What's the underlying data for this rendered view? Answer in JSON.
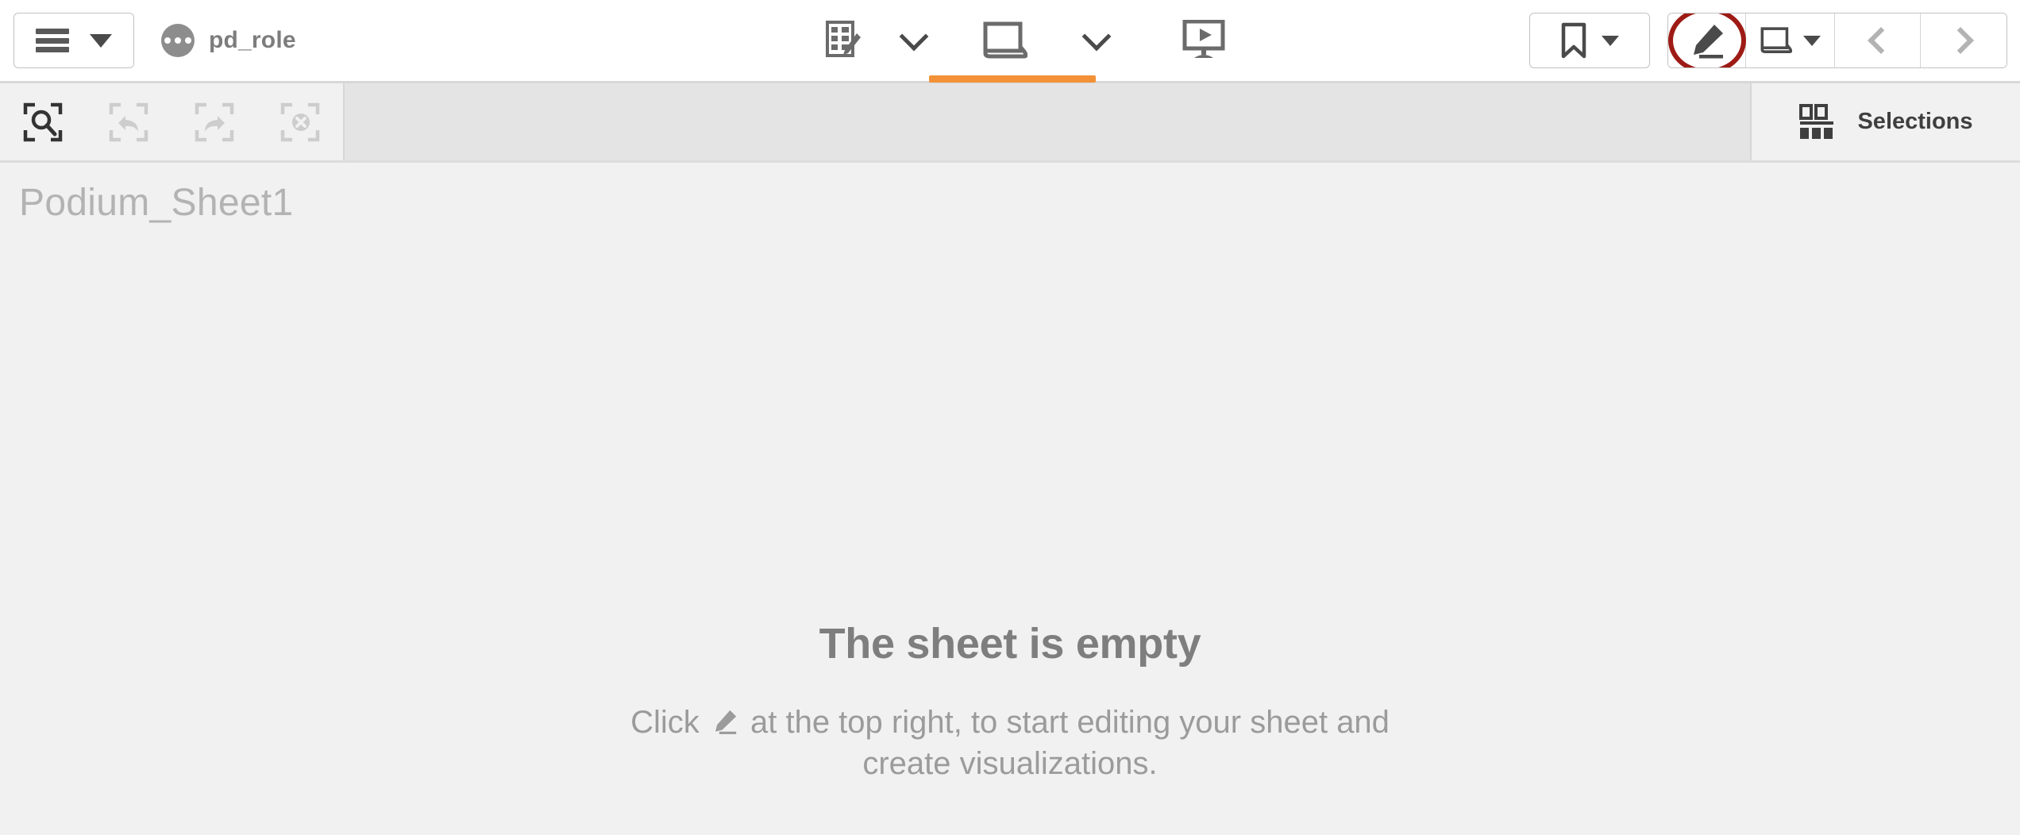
{
  "topbar": {
    "nav_button": {
      "label": "Navigation menu",
      "icon": "hamburger-icon",
      "caret": "chevron-down-icon"
    },
    "app": {
      "name": "pd_role",
      "icon": "app-dots-icon"
    },
    "center_tools": [
      {
        "name": "data-manager",
        "icon": "sheet-edit-icon",
        "label": "Data manager"
      },
      {
        "name": "data-manager-dropdown",
        "icon": "chevron-down-icon",
        "label": "Data manager options"
      },
      {
        "name": "sheets",
        "icon": "sheet-icon",
        "label": "Sheets",
        "active": true
      },
      {
        "name": "sheets-dropdown",
        "icon": "chevron-down-icon",
        "label": "Sheet options"
      },
      {
        "name": "storytelling",
        "icon": "presentation-play-icon",
        "label": "Storytelling"
      }
    ],
    "right_tools": [
      {
        "name": "bookmarks",
        "icon": "bookmark-icon",
        "label": "Bookmarks",
        "caret": "chevron-down-icon"
      },
      {
        "name": "edit-sheet",
        "icon": "pencil-icon",
        "label": "Edit sheet",
        "annotated": true
      },
      {
        "name": "sheet-navigation",
        "icon": "sheet-icon",
        "label": "Sheet navigation",
        "caret": "chevron-down-icon"
      },
      {
        "name": "previous-sheet",
        "icon": "chevron-left-icon",
        "label": "Previous sheet"
      },
      {
        "name": "next-sheet",
        "icon": "chevron-right-icon",
        "label": "Next sheet"
      }
    ]
  },
  "selections_bar": {
    "tools": [
      {
        "name": "selections-search",
        "icon": "selection-search-icon",
        "label": "Search selections",
        "enabled": true
      },
      {
        "name": "step-back",
        "icon": "selection-back-icon",
        "label": "Step back",
        "enabled": false
      },
      {
        "name": "step-forward",
        "icon": "selection-forward-icon",
        "label": "Step forward",
        "enabled": false
      },
      {
        "name": "clear-selections",
        "icon": "selection-clear-icon",
        "label": "Clear all selections",
        "enabled": false
      }
    ],
    "panel": {
      "label": "Selections",
      "icon": "selections-bar-icon"
    }
  },
  "sheet": {
    "title": "Podium_Sheet1",
    "empty_heading": "The sheet is empty",
    "empty_text_before": "Click",
    "empty_text_after": "at the top right, to start editing your sheet and create visualizations."
  },
  "colors": {
    "accent_orange": "#f29137",
    "annotation_red": "#9e1b15",
    "page_background": "#f1f1f1",
    "topbar_background": "#ffffff",
    "text_muted": "#9b9b9b"
  }
}
